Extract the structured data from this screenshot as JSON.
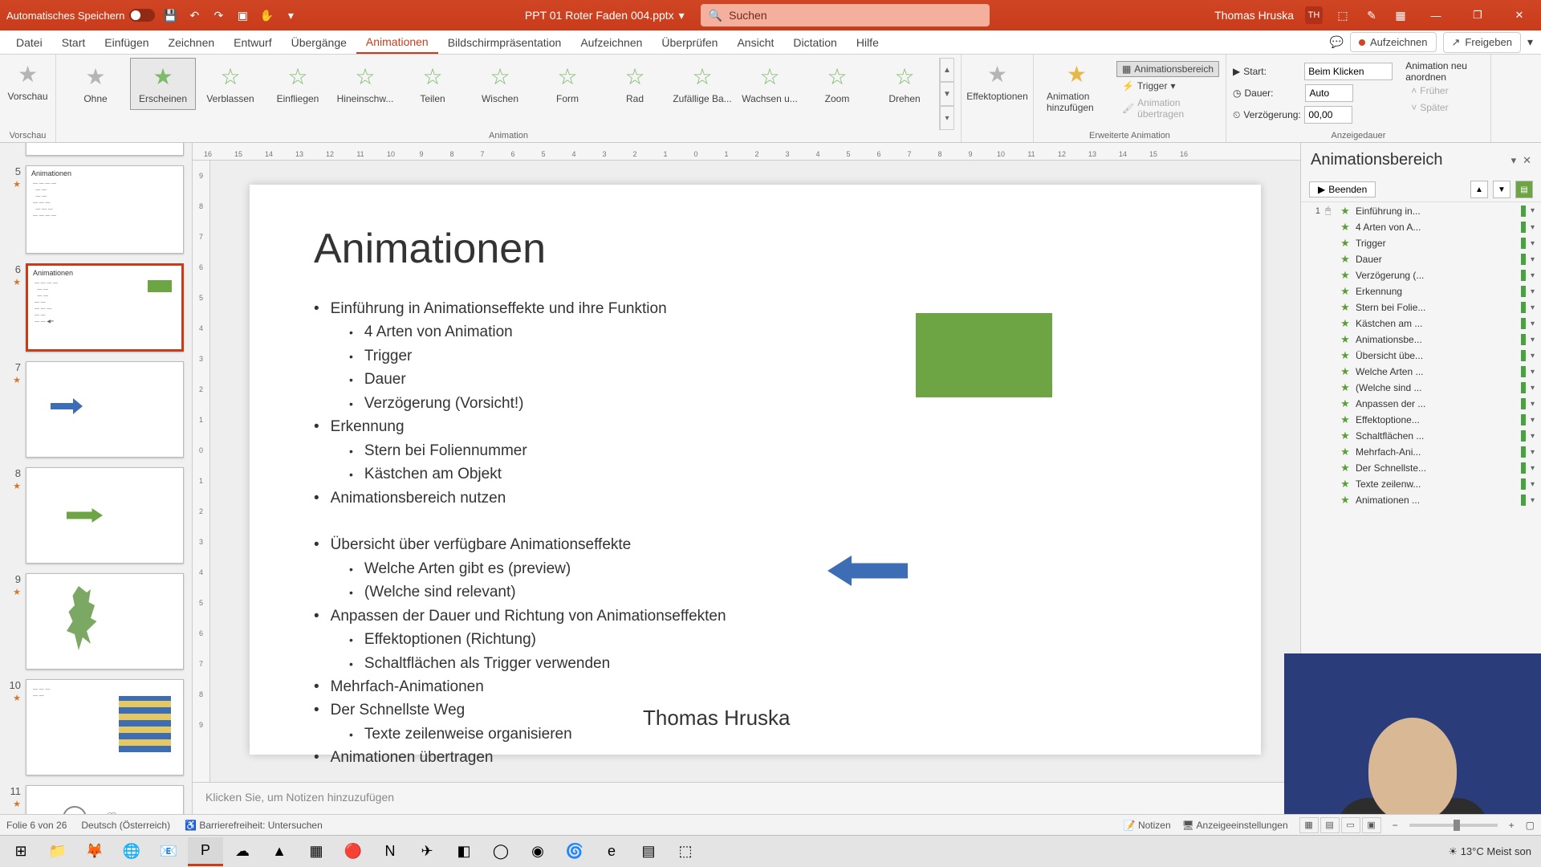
{
  "titlebar": {
    "autosave": "Automatisches Speichern",
    "filename": "PPT 01 Roter Faden 004.pptx",
    "search_placeholder": "Suchen",
    "user": "Thomas Hruska",
    "user_initials": "TH"
  },
  "ribbonTabs": {
    "file": "Datei",
    "home": "Start",
    "insert": "Einfügen",
    "draw": "Zeichnen",
    "design": "Entwurf",
    "transitions": "Übergänge",
    "animations": "Animationen",
    "slideshow": "Bildschirmpräsentation",
    "record": "Aufzeichnen",
    "review": "Überprüfen",
    "view": "Ansicht",
    "dictation": "Dictation",
    "help": "Hilfe",
    "recbtn": "Aufzeichnen",
    "sharebtn": "Freigeben"
  },
  "ribbon": {
    "preview": "Vorschau",
    "preview_group": "Vorschau",
    "gallery": {
      "none": "Ohne",
      "appear": "Erscheinen",
      "fade": "Verblassen",
      "fly": "Einfliegen",
      "float": "Hineinschw...",
      "split": "Teilen",
      "wipe": "Wischen",
      "shape": "Form",
      "wheel": "Rad",
      "random": "Zufällige Ba...",
      "grow": "Wachsen u...",
      "zoom": "Zoom",
      "swivel": "Drehen"
    },
    "animation_group": "Animation",
    "effect_options": "Effektoptionen",
    "add_anim": "Animation hinzufügen",
    "anim_pane_btn": "Animationsbereich",
    "trigger": "Trigger",
    "anim_painter": "Animation übertragen",
    "ext_group": "Erweiterte Animation",
    "start_lbl": "Start:",
    "start_val": "Beim Klicken",
    "dur_lbl": "Dauer:",
    "dur_val": "Auto",
    "delay_lbl": "Verzögerung:",
    "delay_val": "00,00",
    "reorder": "Animation neu anordnen",
    "earlier": "Früher",
    "later": "Später",
    "timing_group": "Anzeigedauer"
  },
  "thumbs": [
    {
      "n": "5",
      "title": "Animationen"
    },
    {
      "n": "6",
      "title": "Animationen",
      "selected": true
    },
    {
      "n": "7"
    },
    {
      "n": "8"
    },
    {
      "n": "9"
    },
    {
      "n": "10"
    },
    {
      "n": "11"
    }
  ],
  "slide": {
    "title": "Animationen",
    "b1": "Einführung in Animationseffekte und ihre Funktion",
    "b1a": "4 Arten von Animation",
    "b1b": "Trigger",
    "b1c": "Dauer",
    "b1d": "Verzögerung (Vorsicht!)",
    "b2": "Erkennung",
    "b2a": "Stern bei Foliennummer",
    "b2b": "Kästchen am Objekt",
    "b3": "Animationsbereich nutzen",
    "b4": "Übersicht über verfügbare Animationseffekte",
    "b4a": "Welche Arten gibt es (preview)",
    "b4b": "(Welche sind relevant)",
    "b5": "Anpassen der Dauer und Richtung von Animationseffekten",
    "b5a": "Effektoptionen (Richtung)",
    "b5b": "Schaltflächen als Trigger verwenden",
    "b6": "Mehrfach-Animationen",
    "b7": "Der Schnellste Weg",
    "b7a": "Texte zeilenweise organisieren",
    "b8": "Animationen übertragen",
    "author": "Thomas Hruska"
  },
  "notes": {
    "placeholder": "Klicken Sie, um Notizen hinzuzufügen"
  },
  "animPane": {
    "title": "Animationsbereich",
    "play": "Beenden",
    "items": [
      {
        "n": "1",
        "label": "Einführung in..."
      },
      {
        "label": "4 Arten von A..."
      },
      {
        "label": "Trigger"
      },
      {
        "label": "Dauer"
      },
      {
        "label": "Verzögerung (..."
      },
      {
        "label": "Erkennung"
      },
      {
        "label": "Stern bei Folie..."
      },
      {
        "label": "Kästchen am ..."
      },
      {
        "label": "Animationsbe..."
      },
      {
        "label": "Übersicht übe..."
      },
      {
        "label": "Welche Arten ..."
      },
      {
        "label": "(Welche sind ..."
      },
      {
        "label": "Anpassen der ..."
      },
      {
        "label": "Effektoptione..."
      },
      {
        "label": "Schaltflächen ..."
      },
      {
        "label": "Mehrfach-Ani..."
      },
      {
        "label": "Der Schnellste..."
      },
      {
        "label": "Texte zeilenw..."
      },
      {
        "label": "Animationen ..."
      }
    ]
  },
  "status": {
    "slide_of": "Folie 6 von 26",
    "lang": "Deutsch (Österreich)",
    "access": "Barrierefreiheit: Untersuchen",
    "notes_btn": "Notizen",
    "display_btn": "Anzeigeeinstellungen"
  },
  "taskbar": {
    "weather": "13°C  Meist son"
  },
  "ruler_h": [
    "16",
    "15",
    "14",
    "13",
    "12",
    "11",
    "10",
    "9",
    "8",
    "7",
    "6",
    "5",
    "4",
    "3",
    "2",
    "1",
    "0",
    "1",
    "2",
    "3",
    "4",
    "5",
    "6",
    "7",
    "8",
    "9",
    "10",
    "11",
    "12",
    "13",
    "14",
    "15",
    "16"
  ],
  "ruler_v": [
    "9",
    "8",
    "7",
    "6",
    "5",
    "4",
    "3",
    "2",
    "1",
    "0",
    "1",
    "2",
    "3",
    "4",
    "5",
    "6",
    "7",
    "8",
    "9"
  ]
}
